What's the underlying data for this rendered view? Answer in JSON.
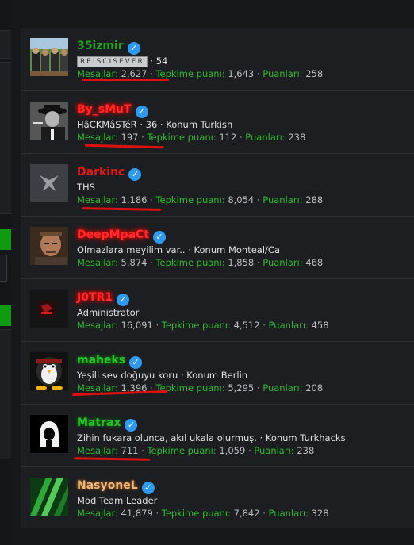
{
  "members": [
    {
      "name": "35izmir",
      "verified": true,
      "banner": "REISCISEVER",
      "info": "· 54",
      "stats": {
        "mesajlar_label": "Mesajlar:",
        "mesajlar": "2,627",
        "tepkime_label": "Tepkime puanı:",
        "tepkime": "1,643",
        "puan_label": "Puanları:",
        "puan": "258"
      }
    },
    {
      "name": "By_sMuT",
      "verified": true,
      "info": "HâCKMâSTéR · 36 · Konum Türkish",
      "stats": {
        "mesajlar_label": "Mesajlar:",
        "mesajlar": "197",
        "tepkime_label": "Tepkime puanı:",
        "tepkime": "112",
        "puan_label": "Puanları:",
        "puan": "238"
      }
    },
    {
      "name": "Darkinc",
      "verified": true,
      "info": "THS",
      "stats": {
        "mesajlar_label": "Mesajlar:",
        "mesajlar": "1,186",
        "tepkime_label": "Tepkime puanı:",
        "tepkime": "8,054",
        "puan_label": "Puanları:",
        "puan": "288"
      }
    },
    {
      "name": "DeepMpaCt",
      "verified": true,
      "info": "Olmazlara meyilim var.. · Konum Monteal/Ca",
      "stats": {
        "mesajlar_label": "Mesajlar:",
        "mesajlar": "5,874",
        "tepkime_label": "Tepkime puanı:",
        "tepkime": "1,858",
        "puan_label": "Puanları:",
        "puan": "468"
      }
    },
    {
      "name": "J0TR1",
      "verified": true,
      "info": "Administrator",
      "stats": {
        "mesajlar_label": "Mesajlar:",
        "mesajlar": "16,091",
        "tepkime_label": "Tepkime puanı:",
        "tepkime": "4,512",
        "puan_label": "Puanları:",
        "puan": "458"
      }
    },
    {
      "name": "maheks",
      "verified": true,
      "info": "Yeşili sev doğuyu koru · Konum Berlin",
      "stats": {
        "mesajlar_label": "Mesajlar:",
        "mesajlar": "1,396",
        "tepkime_label": "Tepkime puanı:",
        "tepkime": "5,295",
        "puan_label": "Puanları:",
        "puan": "208"
      }
    },
    {
      "name": "Matrax",
      "verified": true,
      "info": "Zihin fukara olunca, akıl ukala olurmuş. · Konum Turkhacks",
      "stats": {
        "mesajlar_label": "Mesajlar:",
        "mesajlar": "711",
        "tepkime_label": "Tepkime puanı:",
        "tepkime": "1,059",
        "puan_label": "Puanları:",
        "puan": "238"
      }
    },
    {
      "name": "NasyoneL",
      "verified": true,
      "info": "Mod Team Leader",
      "stats": {
        "mesajlar_label": "Mesajlar:",
        "mesajlar": "41,879",
        "tepkime_label": "Tepkime puanı:",
        "tepkime": "7,842",
        "puan_label": "Puanları:",
        "puan": "328"
      }
    }
  ],
  "sep": "·",
  "colors": {
    "label_green": "#2dbb2d",
    "verified_blue": "#2f9bf0",
    "underline_red": "#e01010",
    "background": "#16181a"
  }
}
